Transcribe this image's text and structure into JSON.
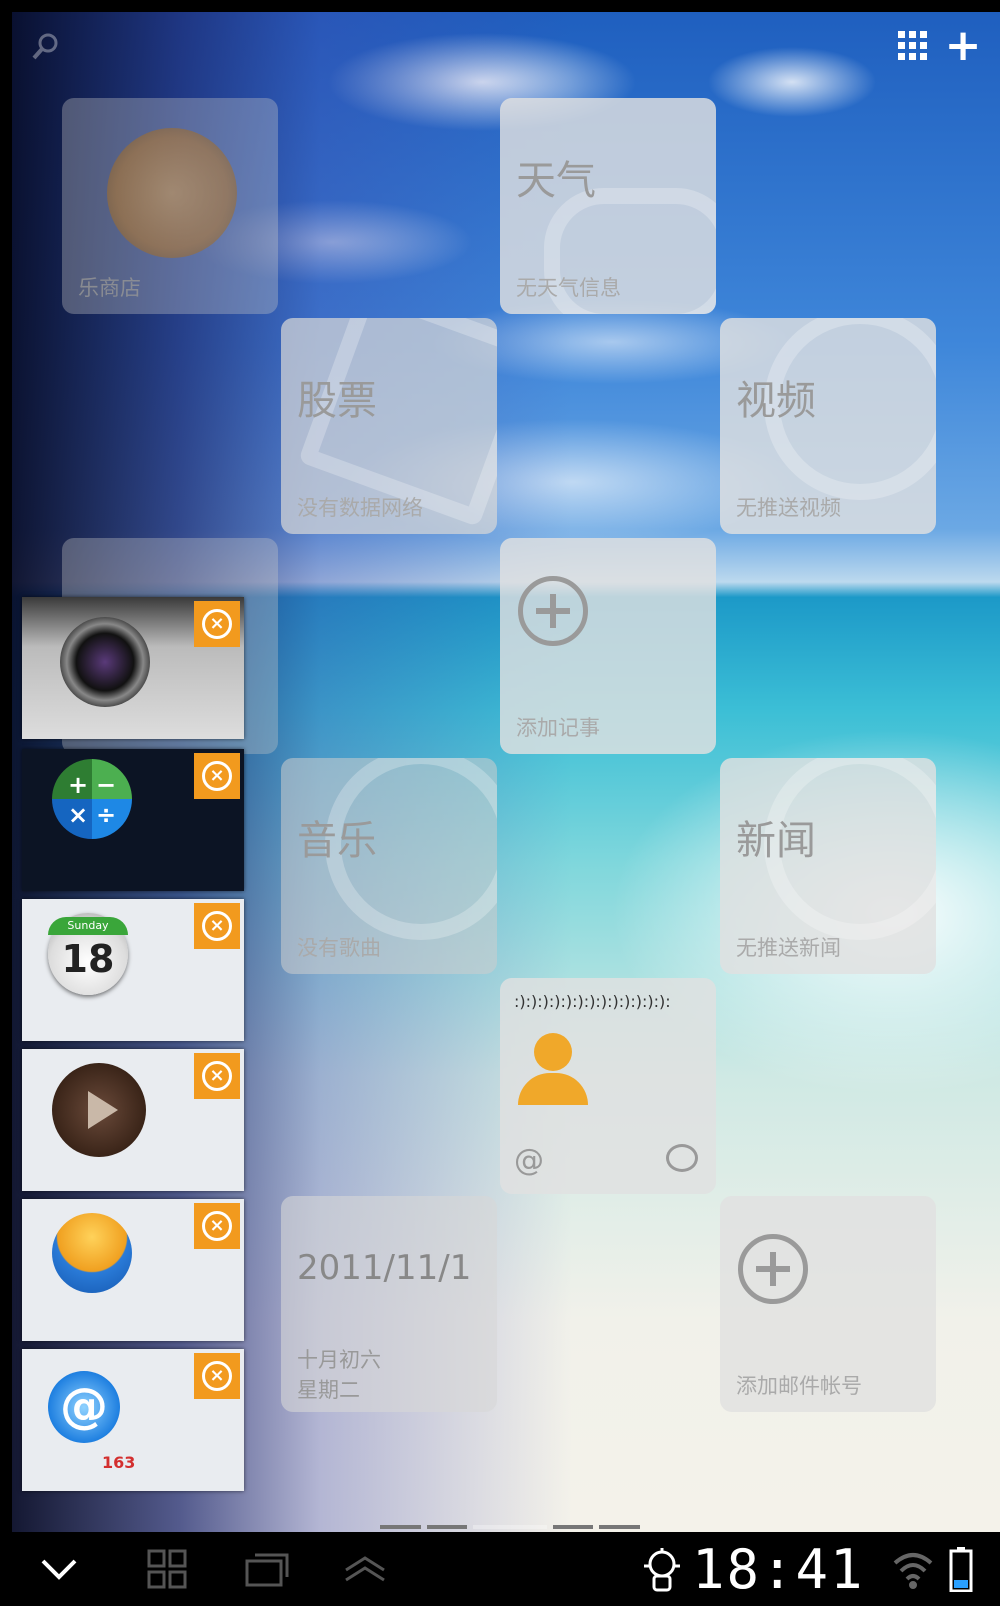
{
  "top_actions": {
    "grid_icon": "grid-icon",
    "add_icon": "plus-icon",
    "add_symbol": "+"
  },
  "tiles": {
    "store_label": "乐商店",
    "weather": {
      "title": "天气",
      "subtitle": "无天气信息"
    },
    "stocks": {
      "title": "股票",
      "subtitle": "没有数据网络"
    },
    "video": {
      "title": "视频",
      "subtitle": "无推送视频"
    },
    "notes": {
      "subtitle": "添加记事"
    },
    "music": {
      "title": "音乐",
      "subtitle": "没有歌曲"
    },
    "news": {
      "title": "新闻",
      "subtitle": "无推送新闻"
    },
    "contact": {
      "status": ":):):):):):):):):):):):):):",
      "at_symbol": "@"
    },
    "date": {
      "date": "2011/11/1",
      "lunar": "十月初六",
      "weekday": "星期二"
    },
    "email": {
      "subtitle": "添加邮件帐号"
    }
  },
  "recent_apps": [
    {
      "name": "camera",
      "icon": "camera-icon"
    },
    {
      "name": "calculator",
      "icon": "calculator-icon"
    },
    {
      "name": "calendar",
      "icon": "calendar-icon",
      "day_label": "Sunday",
      "day_number": "18"
    },
    {
      "name": "video-player",
      "icon": "film-icon"
    },
    {
      "name": "contacts",
      "icon": "contacts-icon"
    },
    {
      "name": "email",
      "icon": "email-icon",
      "brand": "163"
    }
  ],
  "close_symbol": "×",
  "status_bar": {
    "time": "18:41",
    "wifi": "wifi-icon",
    "battery": "battery-icon"
  },
  "nav_bar": {
    "hide": "chevron-down-icon",
    "home": "home-grid-icon",
    "recents": "recent-apps-icon",
    "menu": "menu-up-icon"
  },
  "colors": {
    "accent_orange": "#f29a1e",
    "tile_bg": "#e1e1e1",
    "navbar_bg": "#000000"
  }
}
